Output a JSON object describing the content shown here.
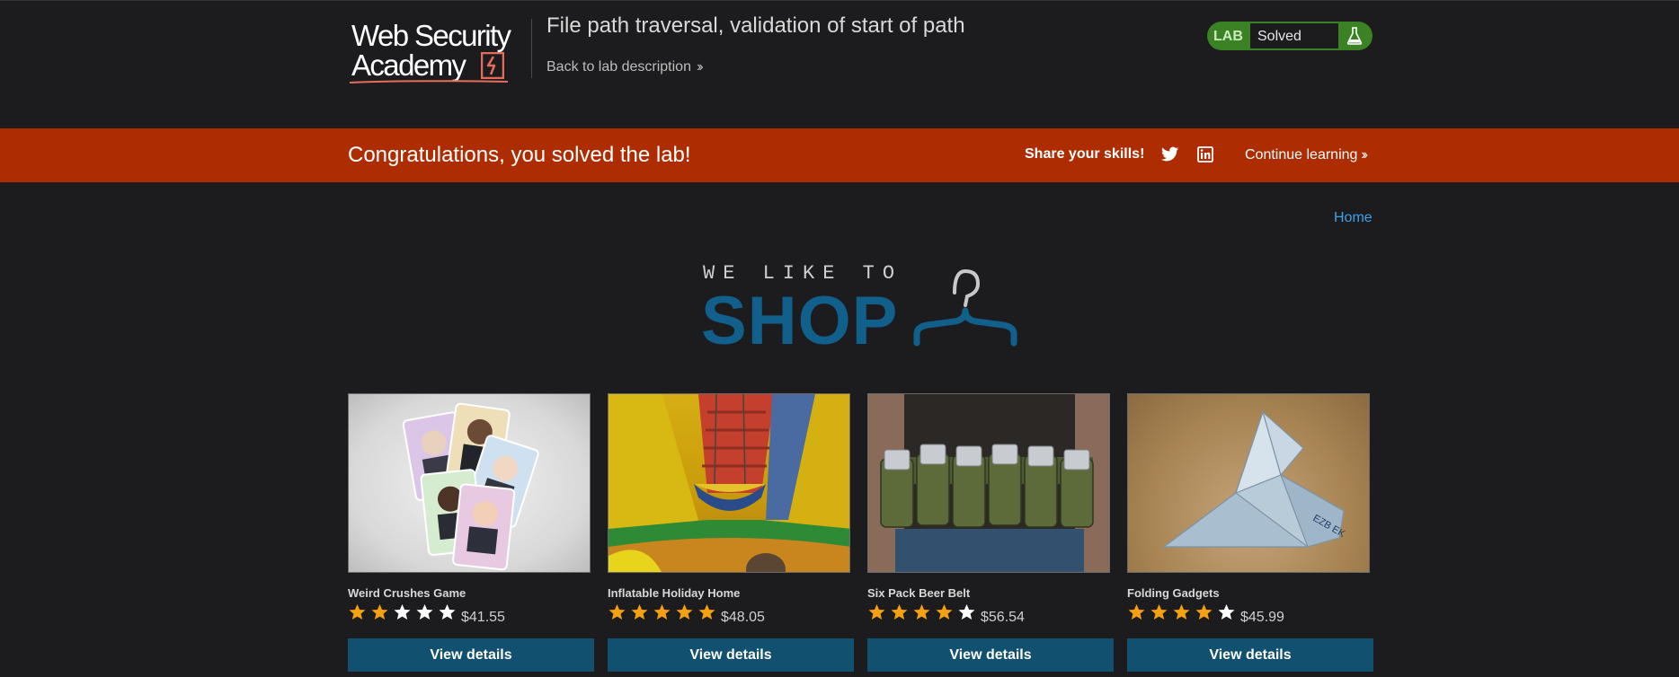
{
  "header": {
    "logo": {
      "line1": "Web Security",
      "line2": "Academy"
    },
    "lab_title": "File path traversal, validation of start of path",
    "back_link": "Back to lab description",
    "lab_badge": {
      "label": "LAB",
      "status": "Solved",
      "icon": "flask-icon"
    }
  },
  "banner": {
    "message": "Congratulations, you solved the lab!",
    "share_label": "Share your skills!",
    "share_icons": [
      "twitter-icon",
      "linkedin-icon"
    ],
    "continue_label": "Continue learning"
  },
  "nav": {
    "home": "Home"
  },
  "shop_logo": {
    "line1": "WE LIKE TO",
    "line2": "SHOP",
    "icon": "hanger-icon"
  },
  "products": [
    {
      "name": "Weird Crushes Game",
      "rating": 2,
      "max_rating": 5,
      "price": "$41.55",
      "button": "View details"
    },
    {
      "name": "Inflatable Holiday Home",
      "rating": 5,
      "max_rating": 5,
      "price": "$48.05",
      "button": "View details"
    },
    {
      "name": "Six Pack Beer Belt",
      "rating": 4,
      "max_rating": 5,
      "price": "$56.54",
      "button": "View details"
    },
    {
      "name": "Folding Gadgets",
      "rating": 4,
      "max_rating": 5,
      "price": "$45.99",
      "button": "View details"
    }
  ],
  "colors": {
    "background": "#1c1c1f",
    "banner": "#ae2c02",
    "lab_badge": "#3b8224",
    "button": "#11506f",
    "shop_blue": "#11608b",
    "link": "#3fa0e8",
    "star_filled": "#f5a00e",
    "star_empty": "#ffffff"
  }
}
